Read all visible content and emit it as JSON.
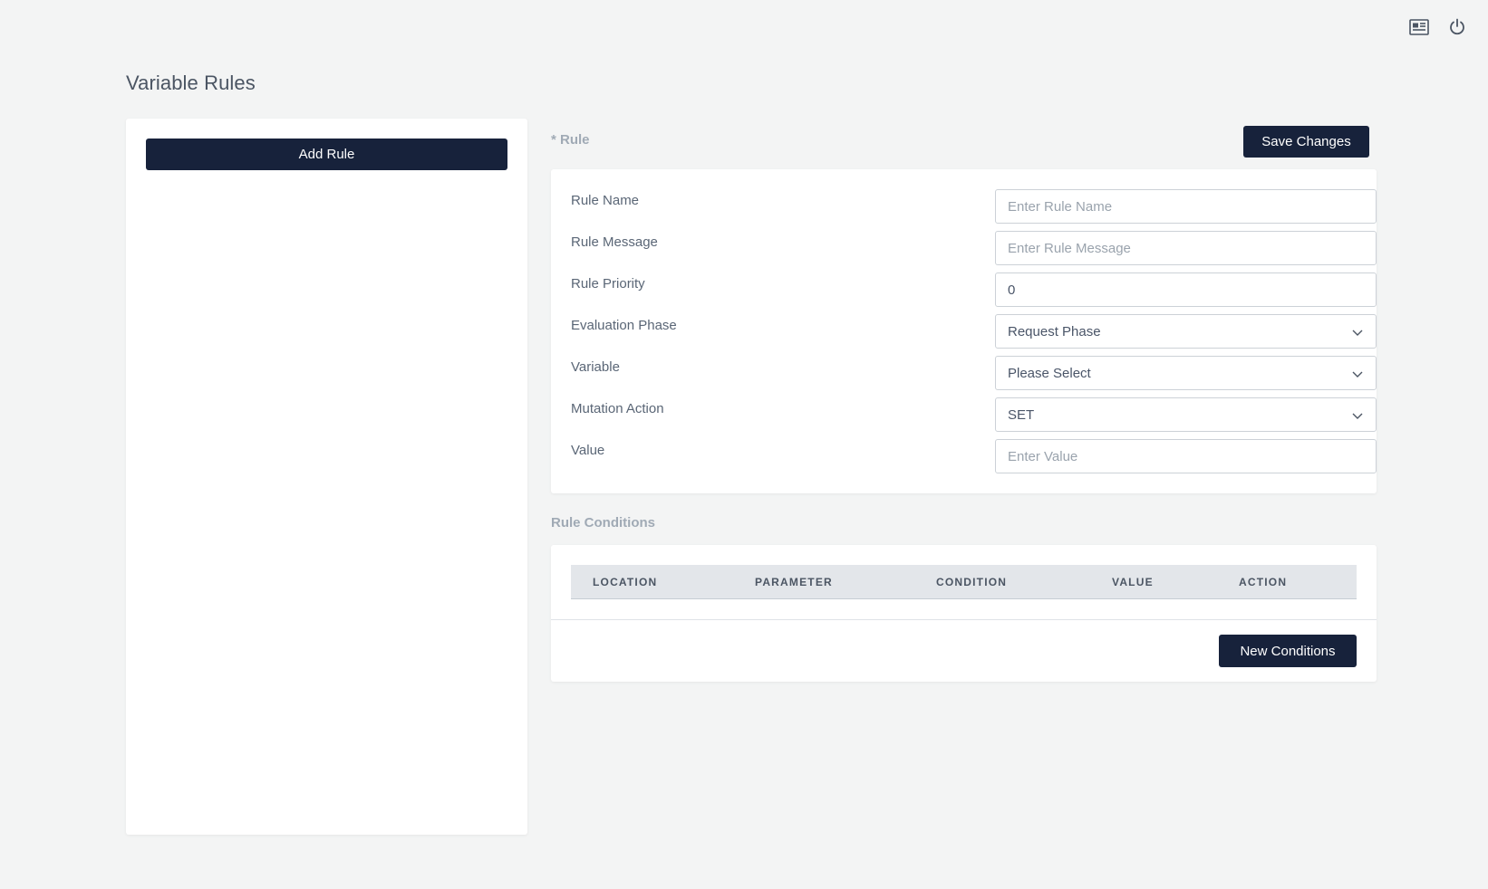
{
  "header": {
    "icons": [
      "news-icon",
      "power-icon"
    ]
  },
  "page": {
    "title": "Variable Rules"
  },
  "sidebar": {
    "add_rule_label": "Add Rule"
  },
  "rule": {
    "section_label": "* Rule",
    "save_label": "Save Changes",
    "fields": [
      {
        "label": "Rule Name",
        "value": "",
        "placeholder": "Enter Rule Name",
        "type": "input"
      },
      {
        "label": "Rule Message",
        "value": "",
        "placeholder": "Enter Rule Message",
        "type": "input"
      },
      {
        "label": "Rule Priority",
        "value": "0",
        "placeholder": "",
        "type": "input"
      },
      {
        "label": "Evaluation Phase",
        "value": "Request Phase",
        "placeholder": "",
        "type": "select"
      },
      {
        "label": "Variable",
        "value": "Please Select",
        "placeholder": "",
        "type": "select"
      },
      {
        "label": "Mutation Action",
        "value": "SET",
        "placeholder": "",
        "type": "select"
      },
      {
        "label": "Value",
        "value": "",
        "placeholder": "Enter Value",
        "type": "input"
      }
    ]
  },
  "conditions": {
    "section_label": "Rule Conditions",
    "columns": [
      "LOCATION",
      "PARAMETER",
      "CONDITION",
      "VALUE",
      "ACTION"
    ],
    "rows": [],
    "new_label": "New Conditions"
  },
  "colors": {
    "primary": "#17223b",
    "background": "#f3f4f4",
    "muted_label": "#a0aab5"
  }
}
